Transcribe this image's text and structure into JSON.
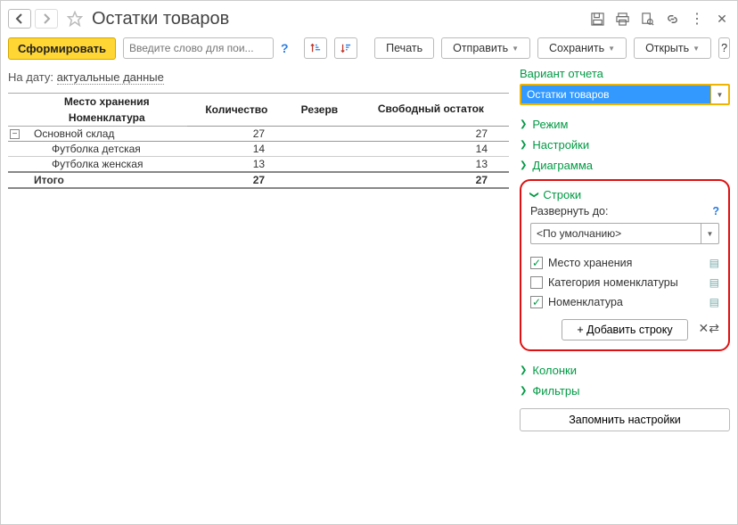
{
  "title": "Остатки товаров",
  "toolbar": {
    "generate": "Сформировать",
    "search_placeholder": "Введите слово для пои...",
    "print": "Печать",
    "send": "Отправить",
    "save": "Сохранить",
    "open": "Открыть"
  },
  "filter": {
    "label": "На дату:",
    "value": "актуальные данные"
  },
  "grid": {
    "headers": {
      "storage": "Место хранения",
      "nomenclature": "Номенклатура",
      "qty": "Количество",
      "reserve": "Резерв",
      "free": "Свободный остаток"
    },
    "group": {
      "name": "Основной склад",
      "qty": "27",
      "reserve": "",
      "free": "27"
    },
    "rows": [
      {
        "name": "Футболка детская",
        "qty": "14",
        "reserve": "",
        "free": "14"
      },
      {
        "name": "Футболка женская",
        "qty": "13",
        "reserve": "",
        "free": "13"
      }
    ],
    "total": {
      "label": "Итого",
      "qty": "27",
      "reserve": "",
      "free": "27"
    }
  },
  "side": {
    "variant_title": "Вариант отчета",
    "variant_value": "Остатки товаров",
    "sections": {
      "mode": "Режим",
      "settings": "Настройки",
      "diagram": "Диаграмма",
      "rows": "Строки",
      "columns": "Колонки",
      "filters": "Фильтры"
    },
    "rows_panel": {
      "expand_label": "Развернуть до:",
      "expand_value": "<По умолчанию>",
      "items": {
        "storage": "Место хранения",
        "category": "Категория номенклатуры",
        "nomenclature": "Номенклатура"
      },
      "add": "+ Добавить строку"
    },
    "remember": "Запомнить настройки"
  }
}
